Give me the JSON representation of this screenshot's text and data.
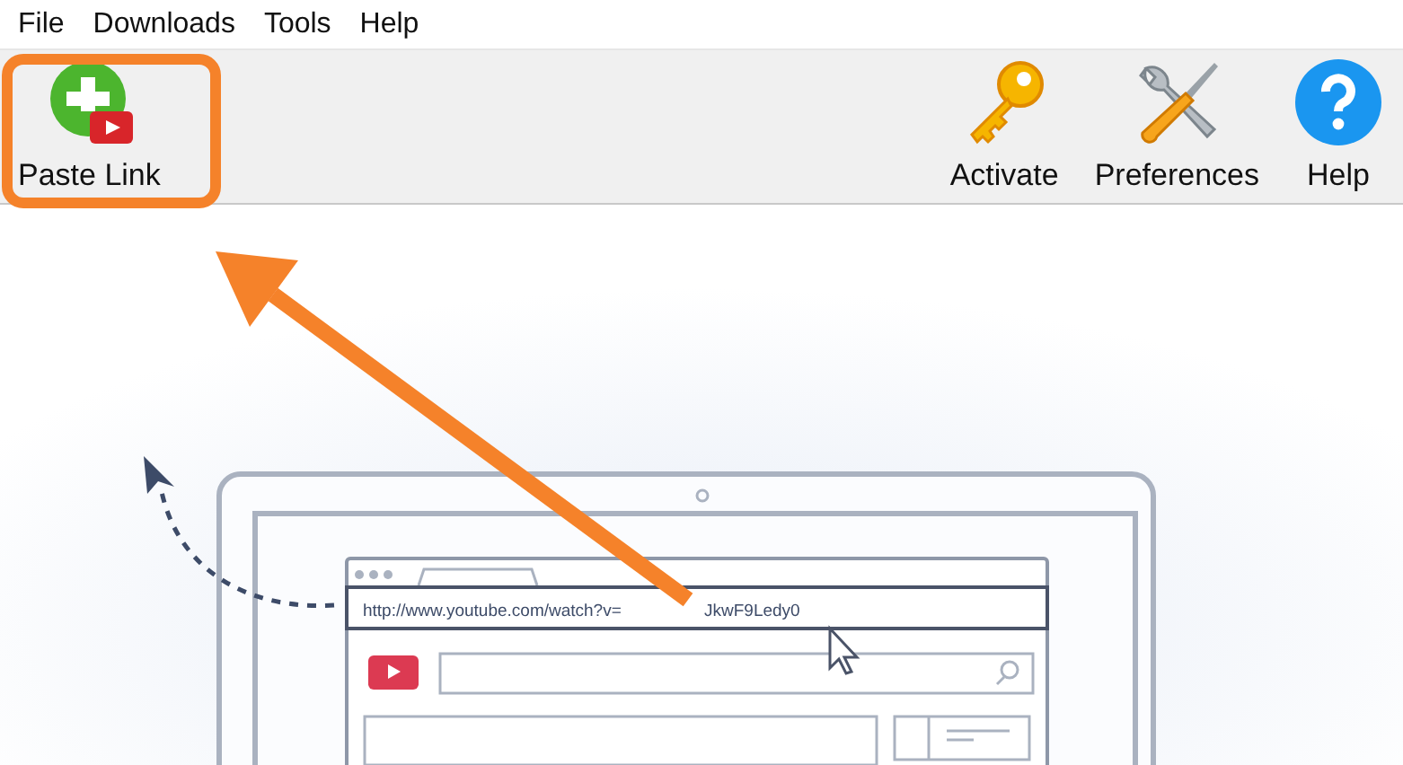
{
  "menu": [
    "File",
    "Downloads",
    "Tools",
    "Help"
  ],
  "toolbar": {
    "left": [
      {
        "kind": "paste",
        "label": "Paste Link"
      }
    ],
    "right": [
      {
        "kind": "key",
        "label": "Activate"
      },
      {
        "kind": "tools",
        "label": "Preferences"
      },
      {
        "kind": "help",
        "label": "Help"
      }
    ]
  },
  "illustration": {
    "url_start": "http://www.youtube.com/watch?v=",
    "url_end": "JkwF9Ledy0"
  }
}
